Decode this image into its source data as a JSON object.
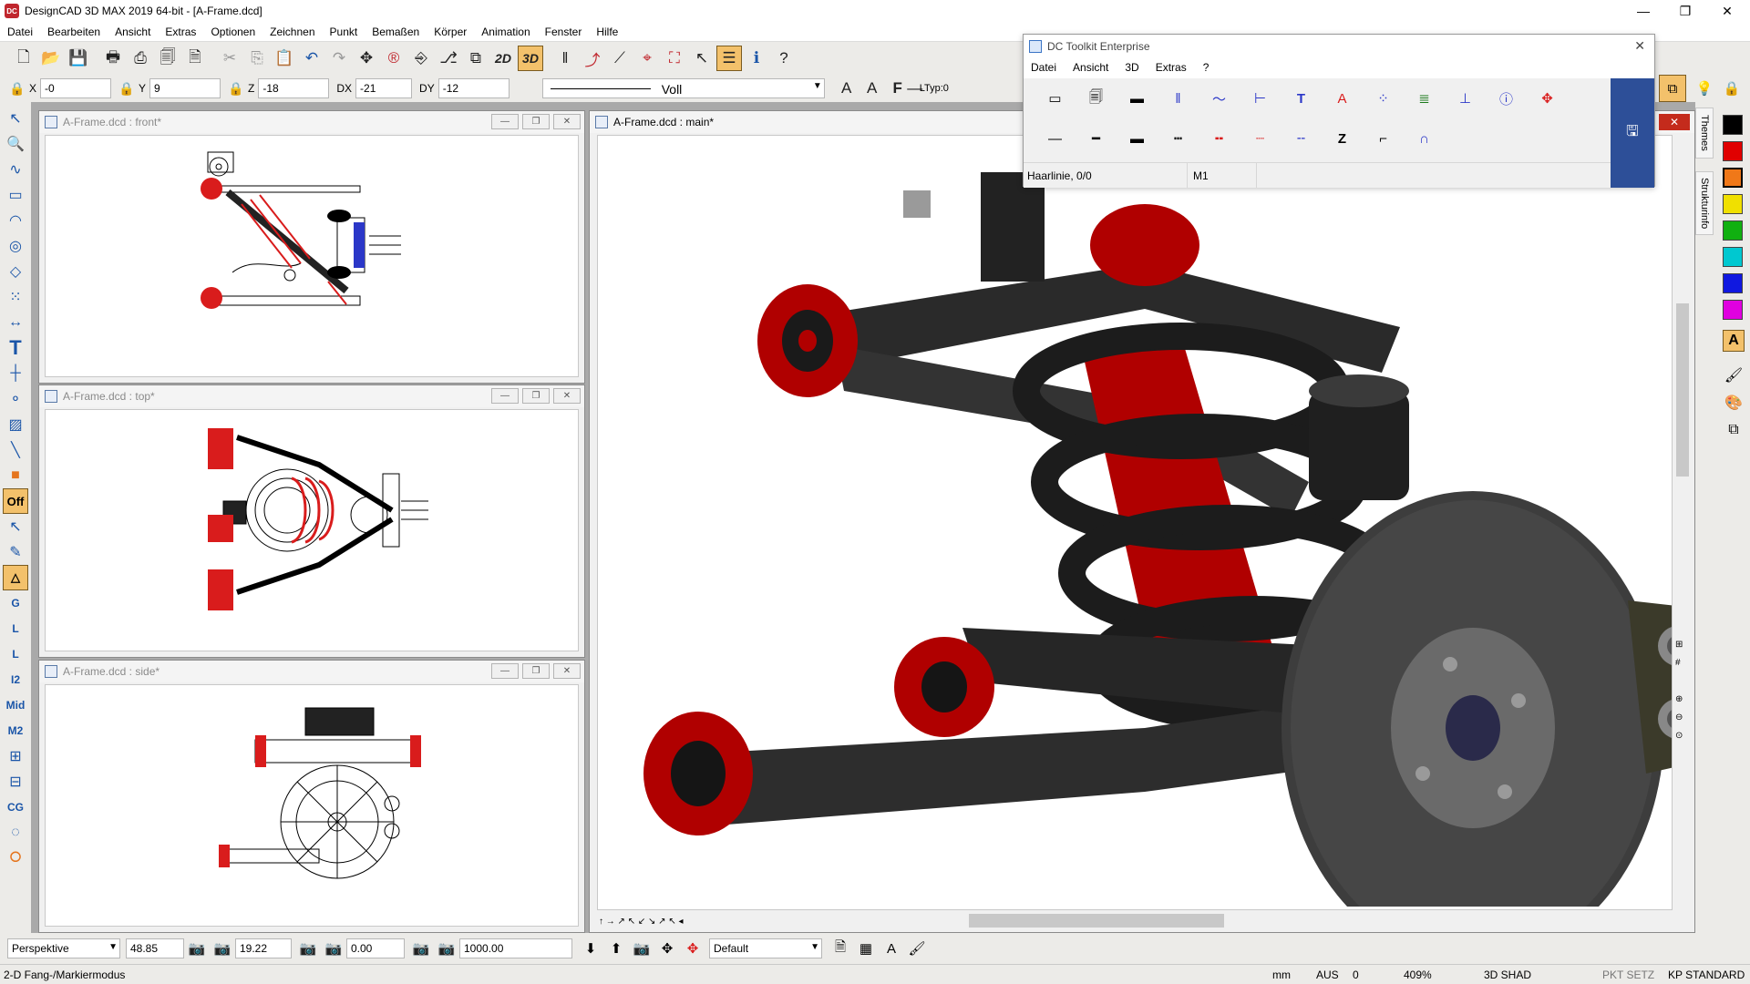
{
  "window": {
    "title": "DesignCAD 3D MAX 2019 64-bit - [A-Frame.dcd]",
    "app_icon": "DC",
    "controls": [
      "—",
      "❐",
      "✕"
    ]
  },
  "menu": [
    "Datei",
    "Bearbeiten",
    "Ansicht",
    "Extras",
    "Optionen",
    "Zeichnen",
    "Punkt",
    "Bemaßen",
    "Körper",
    "Animation",
    "Fenster",
    "Hilfe"
  ],
  "toolbar1": {
    "buttons": [
      "new-icon",
      "open-icon",
      "save-icon",
      "print-icon",
      "print-preview-icon",
      "page-icon",
      "print-setup-icon",
      "cut-icon",
      "copy-icon",
      "paste-icon",
      "undo-icon",
      "redo-icon",
      "move-icon",
      "redraw-icon",
      "view-icon",
      "view2-icon",
      "view3-icon"
    ],
    "mode_2d": "2D",
    "mode_3d": "3D"
  },
  "coords": {
    "x_label": "X",
    "x_value": "-0",
    "y_label": "Y",
    "y_value": "9",
    "z_label": "Z",
    "z_value": "-18",
    "dx_label": "DX",
    "dx_value": "-21",
    "dy_label": "DY",
    "dy_value": "-12"
  },
  "line_style": {
    "value": "Voll",
    "ltype_label": "LTyp:0"
  },
  "left_tools": {
    "off_label": "Off",
    "g_label": "G",
    "l_label": "L",
    "l2_label": "L",
    "i2_label": "I2",
    "mid_label": "Mid",
    "m2_label": "M2",
    "cg_label": "CG"
  },
  "windows": {
    "front": {
      "title": "A-Frame.dcd : front*"
    },
    "top": {
      "title": "A-Frame.dcd : top*"
    },
    "side": {
      "title": "A-Frame.dcd : side*"
    },
    "main": {
      "title": "A-Frame.dcd : main*"
    }
  },
  "toolkit": {
    "title": "DC Toolkit Enterprise",
    "menu": [
      "Datei",
      "Ansicht",
      "3D",
      "Extras",
      "?"
    ],
    "status_line": "Haarlinie, 0/0",
    "status_layer": "M1",
    "text_tool_1": "T",
    "text_tool_2": "A",
    "z_tool": "Z"
  },
  "right_panel": {
    "tab_themes": "Themes",
    "tab_structure": "Strukturinfo",
    "colors": [
      "#000000",
      "#e00000",
      "#f07818",
      "#f0e000",
      "#10b010",
      "#00c8d0",
      "#1018e0",
      "#e000e0"
    ],
    "text_tool": "A"
  },
  "bottom_bar": {
    "projection": "Perspektive",
    "val1": "48.85",
    "val2": "19.22",
    "val3": "0.00",
    "val4": "1000.00",
    "layer_combo": "Default"
  },
  "status": {
    "mode": "2-D Fang-/Markiermodus",
    "unit": "mm",
    "aus": "AUS",
    "num": "0",
    "zoom": "409%",
    "shade": "3D SHAD",
    "pkt": "PKT SETZ",
    "kp": "KP STANDARD"
  }
}
